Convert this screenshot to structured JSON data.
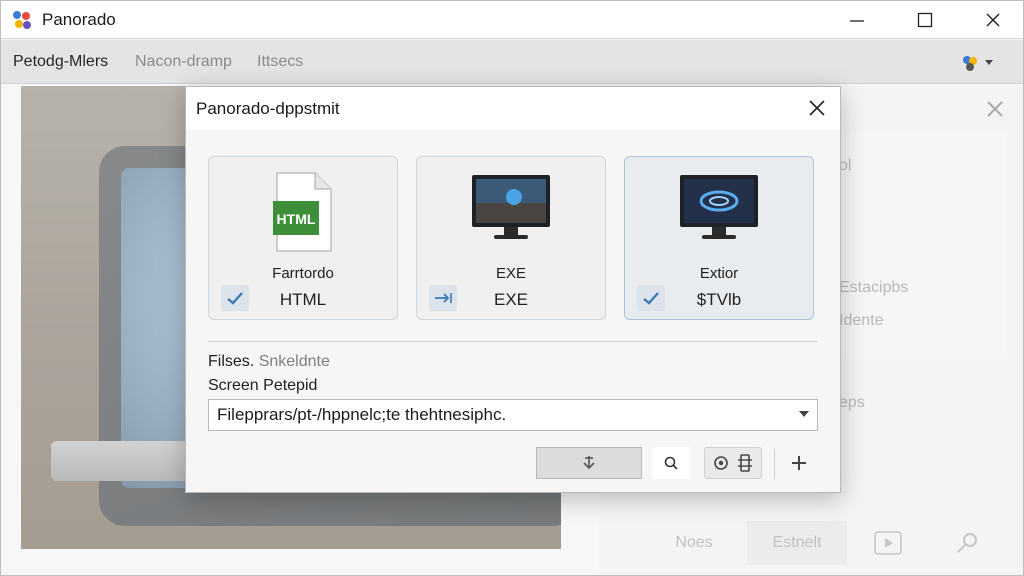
{
  "window": {
    "title": "Panorado",
    "icon": "panorado-logo-icon"
  },
  "window_controls": {
    "minimize": "minimize-icon",
    "maximize": "maximize-icon",
    "close": "close-icon"
  },
  "menu": {
    "items": [
      {
        "label": "Petodg-Mlers",
        "active": true
      },
      {
        "label": "Nacon-dramp",
        "active": false
      },
      {
        "label": "Ittsecs",
        "active": false
      }
    ]
  },
  "side_panel": {
    "texts": [
      "ol",
      "Estacipbs",
      "Idente",
      "eps"
    ],
    "bottom_buttons": [
      "Noes",
      "Estnelt"
    ]
  },
  "dialog": {
    "title": "Panorado-dppstmit",
    "options": [
      {
        "title": "Farrtordo",
        "subtitle": "HTML",
        "icon_text": "HTML",
        "checked": true,
        "check_icon": "checkmark-icon"
      },
      {
        "title": "EXE",
        "subtitle": "EXE",
        "checked": false,
        "check_icon": "arrow-right-icon"
      },
      {
        "title": "Extior",
        "subtitle": "$TVlb",
        "checked": true,
        "check_icon": "checkmark-icon"
      }
    ],
    "files_label": "Filses.",
    "files_hint": "Snkeldnte",
    "screen_label": "Screen Petepid",
    "path_value": "Filepprars/pt-/hppnelc;te thehtnesiphc.",
    "accent": "#3c78b5"
  }
}
